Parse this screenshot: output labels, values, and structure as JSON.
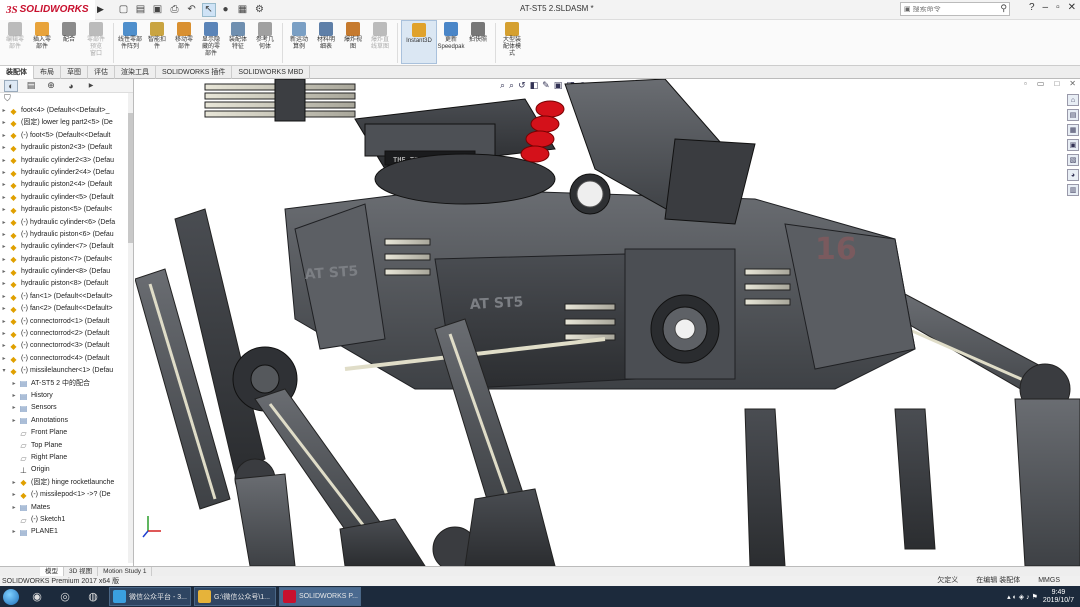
{
  "app": {
    "logo_mark": "3S",
    "logo_text": "SOLIDWORKS",
    "document_title": "AT-ST5 2.SLDASM *",
    "search_placeholder": "搜索命令"
  },
  "quick_access": [
    "new-icon",
    "open-icon",
    "save-icon",
    "print-icon",
    "undo-icon",
    "select-icon",
    "rebuild-icon",
    "file-props-icon",
    "options-icon"
  ],
  "ribbon": {
    "buttons": [
      {
        "label": "编辑零\n部件",
        "icon": "edit-component-icon",
        "color": "#bbbbbb",
        "dim": true
      },
      {
        "label": "插入零\n部件",
        "icon": "insert-component-icon",
        "color": "#e8a33a",
        "dim": false
      },
      {
        "label": "配合",
        "icon": "mate-icon",
        "color": "#8a8a8a",
        "dim": false
      },
      {
        "label": "零部件\n预览\n窗口",
        "icon": "preview-icon",
        "color": "#bbbbbb",
        "dim": true
      },
      {
        "label": "线性零部\n件阵列",
        "icon": "linear-pattern-icon",
        "color": "#4f8fcc",
        "dim": false
      },
      {
        "label": "智能扣\n件",
        "icon": "smart-fastener-icon",
        "color": "#c9a441",
        "dim": false
      },
      {
        "label": "移动零\n部件",
        "icon": "move-component-icon",
        "color": "#d99030",
        "dim": false
      },
      {
        "label": "显示隐\n藏的零\n部件",
        "icon": "show-hidden-icon",
        "color": "#5a84b8",
        "dim": false
      },
      {
        "label": "装配体\n特征",
        "icon": "assembly-feature-icon",
        "color": "#6f8fb0",
        "dim": false
      },
      {
        "label": "参考几\n何体",
        "icon": "reference-geometry-icon",
        "color": "#a0a0a0",
        "dim": false
      },
      {
        "label": "新运动\n算例",
        "icon": "motion-study-icon",
        "color": "#7a9fc4",
        "dim": false
      },
      {
        "label": "材料明\n细表",
        "icon": "bom-icon",
        "color": "#5e7fa8",
        "dim": false
      },
      {
        "label": "爆炸视\n图",
        "icon": "explode-icon",
        "color": "#c67a2e",
        "dim": false
      },
      {
        "label": "爆炸直\n线草图",
        "icon": "explode-line-icon",
        "color": "#bbbbbb",
        "dim": true
      },
      {
        "label": "Instant3D",
        "icon": "instant3d-icon",
        "color": "#e0a22c",
        "dim": false,
        "active": true
      },
      {
        "label": "更新\nSpeedpak",
        "icon": "speedpak-icon",
        "color": "#4a86c8",
        "dim": false
      },
      {
        "label": "拍快照",
        "icon": "snapshot-icon",
        "color": "#777777",
        "dim": false
      },
      {
        "label": "大型装\n配体模\n式",
        "icon": "large-assembly-icon",
        "color": "#d5a030",
        "dim": false
      }
    ]
  },
  "command_tabs": [
    "装配体",
    "布局",
    "草图",
    "评估",
    "渲染工具",
    "SOLIDWORKS 插件",
    "SOLIDWORKS MBD"
  ],
  "active_command_tab": 0,
  "feature_tree": {
    "nodes": [
      {
        "label": "foot<4> (Default<<Default>_",
        "type": "part",
        "child": false
      },
      {
        "label": "(固定) lower leg part2<5> (De",
        "type": "part",
        "child": false
      },
      {
        "label": "(-) foot<5> (Default<<Default",
        "type": "part",
        "child": false
      },
      {
        "label": "hydraulic piston2<3> (Default",
        "type": "part",
        "child": false
      },
      {
        "label": "hydraulic cylinder2<3> (Defau",
        "type": "part",
        "child": false
      },
      {
        "label": "hydraulic cylinder2<4> (Defau",
        "type": "part",
        "child": false
      },
      {
        "label": "hydraulic piston2<4> (Default",
        "type": "part",
        "child": false
      },
      {
        "label": "hydraulic cylinder<5> (Default",
        "type": "part",
        "child": false
      },
      {
        "label": "hydraulic piston<5> (Default<",
        "type": "part",
        "child": false
      },
      {
        "label": "(-) hydraulic cylinder<6> (Defa",
        "type": "part",
        "child": false
      },
      {
        "label": "(-) hydraulic piston<6> (Defau",
        "type": "part",
        "child": false
      },
      {
        "label": "hydraulic cylinder<7> (Default",
        "type": "part",
        "child": false
      },
      {
        "label": "hydraulic piston<7> (Default<",
        "type": "part",
        "child": false
      },
      {
        "label": "hydraulic cylinder<8> (Defau",
        "type": "part",
        "child": false
      },
      {
        "label": "hydraulic piston<8> (Default",
        "type": "part",
        "child": false
      },
      {
        "label": "(-) fan<1> (Default<<Default>",
        "type": "part",
        "child": false
      },
      {
        "label": "(-) fan<2> (Default<<Default>",
        "type": "part",
        "child": false
      },
      {
        "label": "(-) connectorrod<1> (Default",
        "type": "part",
        "child": false
      },
      {
        "label": "(-) connectorrod<2> (Default",
        "type": "part",
        "child": false
      },
      {
        "label": "(-) connectorrod<3> (Default",
        "type": "part",
        "child": false
      },
      {
        "label": "(-) connectorrod<4> (Default",
        "type": "part",
        "child": false
      },
      {
        "label": "(-) missilelauncher<1> (Defau",
        "type": "part",
        "child": false,
        "expanded": true
      },
      {
        "label": "AT-ST5 2 中的配合",
        "type": "folder",
        "child": true
      },
      {
        "label": "History",
        "type": "folder",
        "child": true
      },
      {
        "label": "Sensors",
        "type": "folder",
        "child": true
      },
      {
        "label": "Annotations",
        "type": "folder",
        "child": true
      },
      {
        "label": "Front Plane",
        "type": "plane",
        "child": true
      },
      {
        "label": "Top Plane",
        "type": "plane",
        "child": true
      },
      {
        "label": "Right Plane",
        "type": "plane",
        "child": true
      },
      {
        "label": "Origin",
        "type": "origin",
        "child": true
      },
      {
        "label": "(固定) hinge rocketlaunche",
        "type": "part",
        "child": true
      },
      {
        "label": "(-) missilepod<1> ->? (De",
        "type": "part",
        "child": true
      },
      {
        "label": "Mates",
        "type": "folder",
        "child": true
      },
      {
        "label": "(-) Sketch1",
        "type": "plane",
        "child": true
      },
      {
        "label": "PLANE1",
        "type": "folder",
        "child": true
      }
    ]
  },
  "model": {
    "decal_left": "AT ST5",
    "decal_center": "AT ST5",
    "hull_number": "16",
    "gun_nameplate": "THE TERMINATOR"
  },
  "bottom_tabs": [
    "模型",
    "3D 视图",
    "Motion Study 1"
  ],
  "active_bottom_tab": 0,
  "statusbar": {
    "left": "SOLIDWORKS Premium 2017 x64 版",
    "undefined": "欠定义",
    "editing": "在编辑 装配体",
    "units": "MMGS"
  },
  "taskbar": {
    "items": [
      {
        "label": "微信公众平台 - 3...",
        "color": "#3aa0e0"
      },
      {
        "label": "G:\\微信公众号\\1...",
        "color": "#e6b33a"
      },
      {
        "label": "SOLIDWORKS P...",
        "color": "#c8102e",
        "active": true
      }
    ],
    "time": "9:49",
    "date": "2019/10/7"
  },
  "colors": {
    "accent": "#c8102e",
    "model_body": "#55585c",
    "taskbar": "#1c2a3c"
  }
}
